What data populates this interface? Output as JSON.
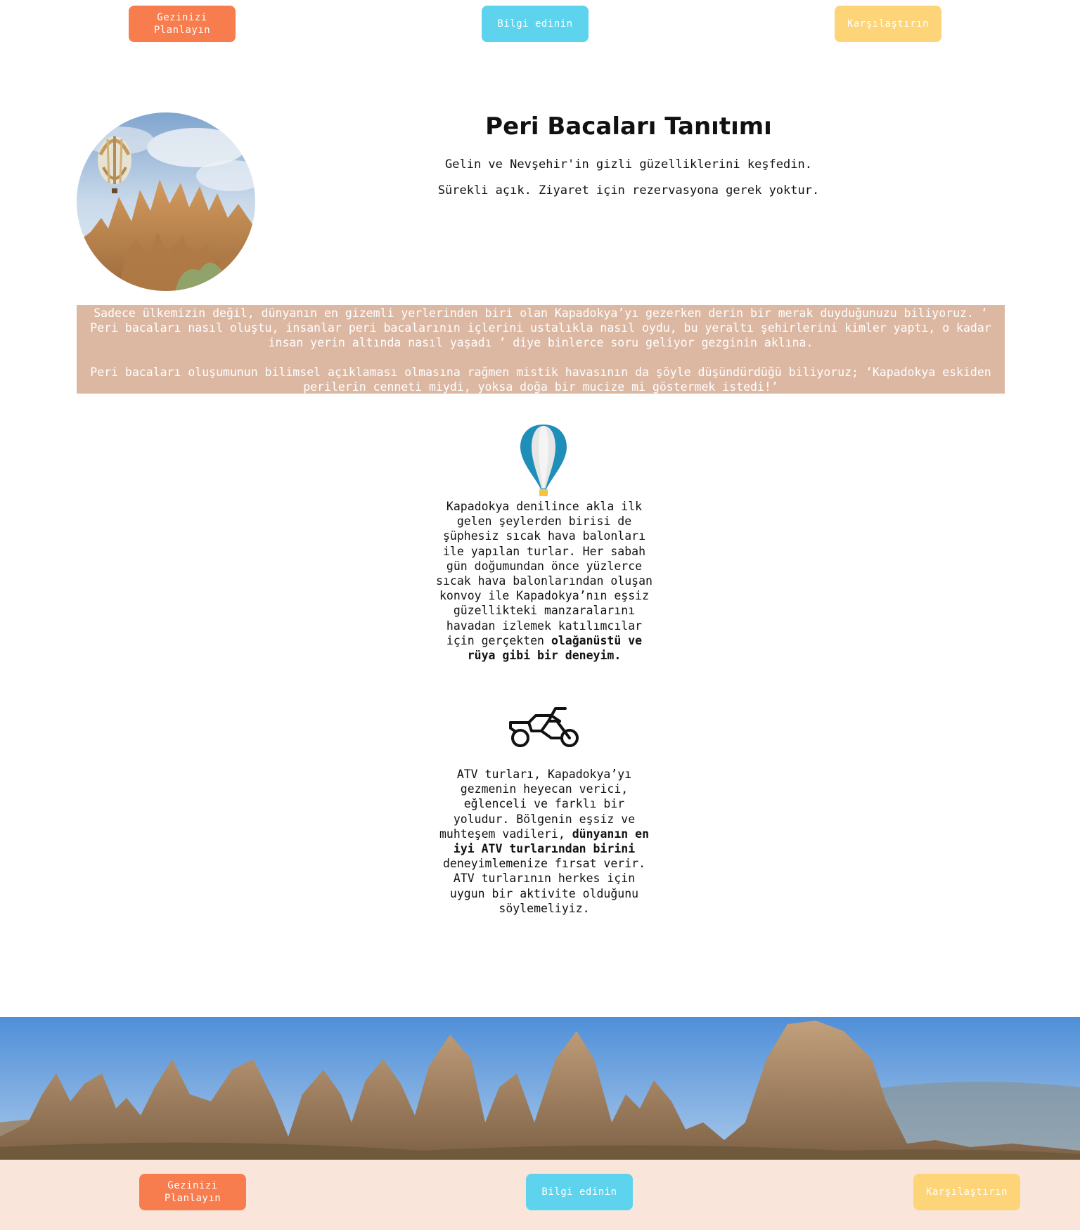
{
  "nav_top": {
    "plan_label": "Gezinizi Planlayın",
    "info_label": "Bilgi edinin",
    "compare_label": "Karşılaştırın"
  },
  "hero": {
    "title": "Peri Bacaları Tanıtımı",
    "subtitle_1": "Gelin ve Nevşehir'in gizli güzelliklerini keşfedin.",
    "subtitle_2": "Sürekli açık. Ziyaret için rezervasyona gerek yoktur."
  },
  "intro": {
    "paragraph_1": "Sadece ülkemizin değil, dünyanın en gizemli yerlerinden biri olan Kapadokya’yı gezerken derin bir merak duyduğunuzu biliyoruz. ‘ Peri bacaları nasıl oluştu, insanlar peri bacalarının içlerini ustalıkla nasıl oydu, bu yeraltı şehirlerini kimler yaptı, o kadar insan yerin altında nasıl yaşadı ’ diye binlerce soru geliyor gezginin aklına.",
    "paragraph_2": "Peri bacaları oluşumunun bilimsel açıklaması olmasına rağmen mistik havasının da şöyle düşündürdüğü biliyoruz; ‘Kapadokya eskiden perilerin cenneti miydi, yoksa doğa bir mucize mi göstermek istedi!’"
  },
  "features": [
    {
      "icon": "hot-air-balloon-icon",
      "text": "Kapadokya denilince akla ilk gelen şeylerden birisi de şüphesiz sıcak hava balonları ile yapılan turlar. Her sabah gün doğumundan önce yüzlerce sıcak hava balonlarından oluşan konvoy ile Kapadokya’nın eşsiz güzellikteki manzaralarını havadan izlemek katılımcılar için gerçekten",
      "bold": "olağanüstü ve rüya gibi bir deneyim."
    },
    {
      "icon": "atv-motorbike-icon",
      "text_before": "ATV turları, Kapadokya’yı gezmenin heyecan verici, eğlenceli ve farklı bir yoludur. Bölgenin eşsiz ve muhteşem vadileri,",
      "bold": "dünyanın en iyi ATV turlarından birini",
      "text_after": "deneyimlemenize fırsat verir. ATV turlarının herkes için uygun bir aktivite olduğunu söylemeliyiz."
    }
  ],
  "nav_bottom": {
    "plan_label": "Gezinizi Planlayın",
    "info_label": "Bilgi edinin",
    "compare_label": "Karşılaştırın"
  },
  "colors": {
    "orange": "#f77c4e",
    "cyan": "#5dd3ed",
    "yellow": "#fdd477",
    "band": "#dcb8a3",
    "footer": "#f9e5da"
  }
}
